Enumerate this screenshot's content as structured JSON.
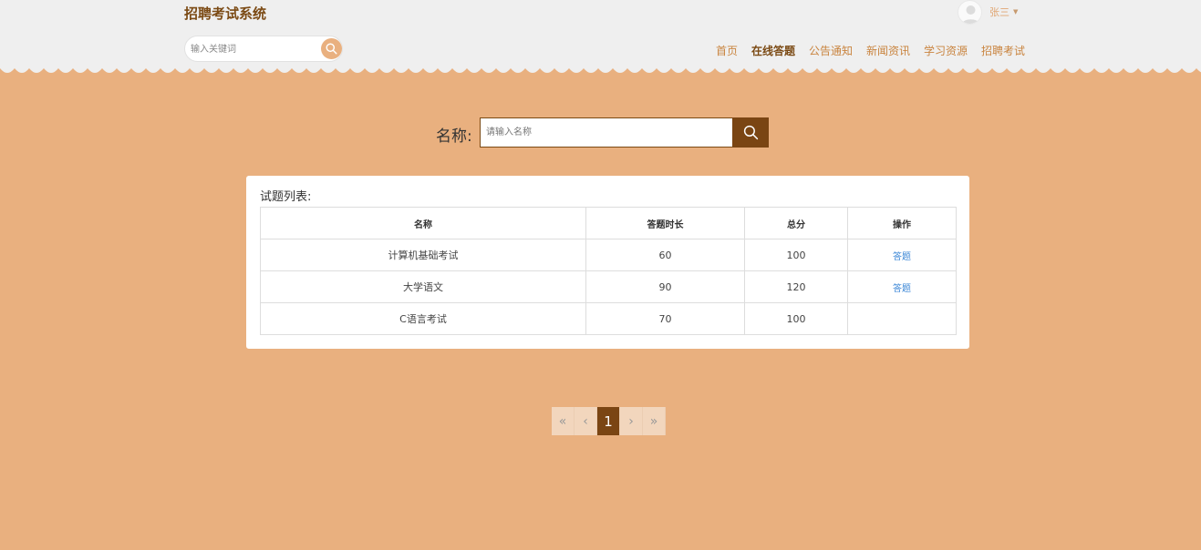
{
  "header": {
    "site_title": "招聘考试系统",
    "search_placeholder": "输入关键词",
    "user_name": "张三"
  },
  "nav": {
    "items": [
      {
        "label": "首页",
        "active": false
      },
      {
        "label": "在线答题",
        "active": true
      },
      {
        "label": "公告通知",
        "active": false
      },
      {
        "label": "新闻资讯",
        "active": false
      },
      {
        "label": "学习资源",
        "active": false
      },
      {
        "label": "招聘考试",
        "active": false
      }
    ]
  },
  "search_bar": {
    "label": "名称:",
    "placeholder": "请输入名称"
  },
  "exam_list": {
    "title": "试题列表:",
    "columns": [
      "名称",
      "答题时长",
      "总分",
      "操作"
    ],
    "rows": [
      {
        "name": "计算机基础考试",
        "duration": "60",
        "score": "100",
        "action": "答题"
      },
      {
        "name": "大学语文",
        "duration": "90",
        "score": "120",
        "action": "答题"
      },
      {
        "name": "C语言考试",
        "duration": "70",
        "score": "100",
        "action": ""
      }
    ]
  },
  "pagination": {
    "first": "«",
    "prev": "‹",
    "current": "1",
    "next": "›",
    "last": "»"
  },
  "colors": {
    "page_background": "#e9b07f",
    "header_background": "#efefef",
    "brand_brown": "#7a4513",
    "nav_text": "#c9843f",
    "link_blue": "#3a86d6"
  },
  "icons": {
    "header_search": "search-icon",
    "main_search": "search-icon",
    "avatar": "user-avatar-icon",
    "user_menu": "caret-down-icon"
  }
}
